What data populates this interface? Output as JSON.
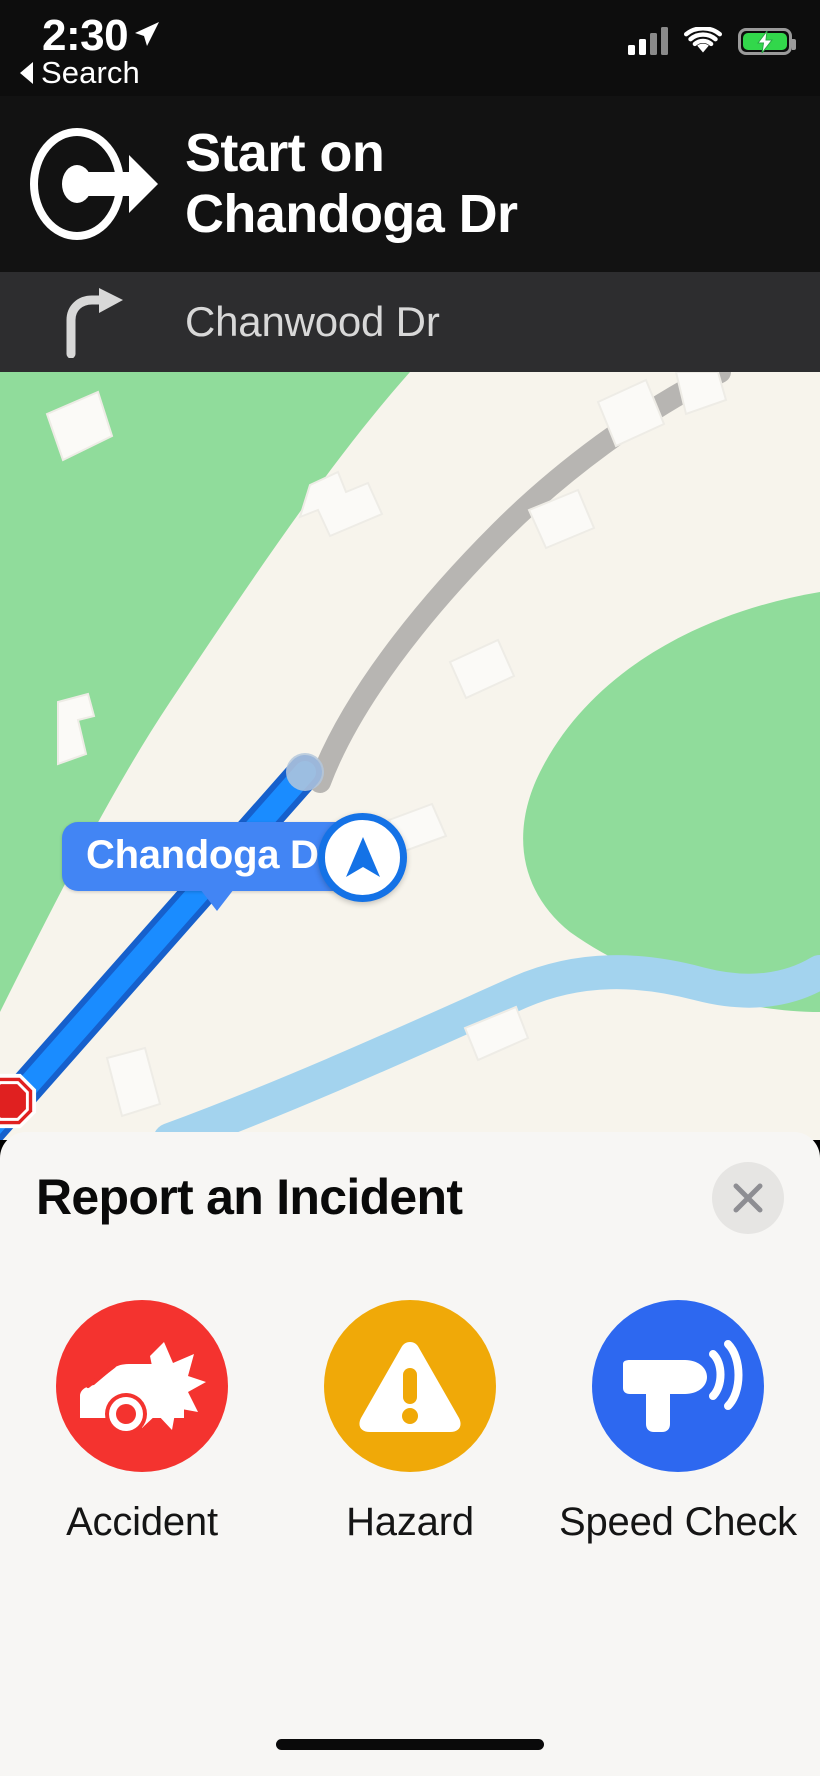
{
  "status_bar": {
    "time": "2:30",
    "location_arrow_icon": "location-arrow-icon",
    "cellular_icon": "cellular-signal-icon",
    "cellular_bars_filled": 2,
    "cellular_bars_total": 4,
    "wifi_icon": "wifi-icon",
    "battery_icon": "battery-charging-icon",
    "battery_charging": true,
    "battery_color": "#32d74b"
  },
  "back": {
    "label": "Search",
    "icon": "back-triangle-icon"
  },
  "banner": {
    "maneuver_icon": "start-on-road-icon",
    "instruction_line1": "Start on",
    "instruction_line2": "Chandoga Dr",
    "background": "#121212"
  },
  "sub_banner": {
    "maneuver_icon": "turn-right-icon",
    "street": "Chanwood Dr",
    "background": "#2d2d2f"
  },
  "map": {
    "road_label": "Chandoga Dr",
    "road_label_color": "#4285f4",
    "route_color": "#1a8cff",
    "route_casing_color": "#1660cc",
    "land_color": "#f7f4ec",
    "park_color": "#90dc9b",
    "water_color": "#a3d3ee",
    "road_color": "#b0aeab",
    "user_puck_icon": "navigation-puck-icon",
    "stop_sign_icon": "stop-sign-icon"
  },
  "sheet": {
    "title": "Report an Incident",
    "close_icon": "close-icon",
    "options": [
      {
        "label": "Accident",
        "icon": "car-crash-icon",
        "color": "#f4332f"
      },
      {
        "label": "Hazard",
        "icon": "warning-triangle-icon",
        "color": "#f0a908"
      },
      {
        "label": "Speed Check",
        "icon": "speed-radar-icon",
        "color": "#2d68f0"
      }
    ]
  },
  "home_indicator": "home-indicator"
}
